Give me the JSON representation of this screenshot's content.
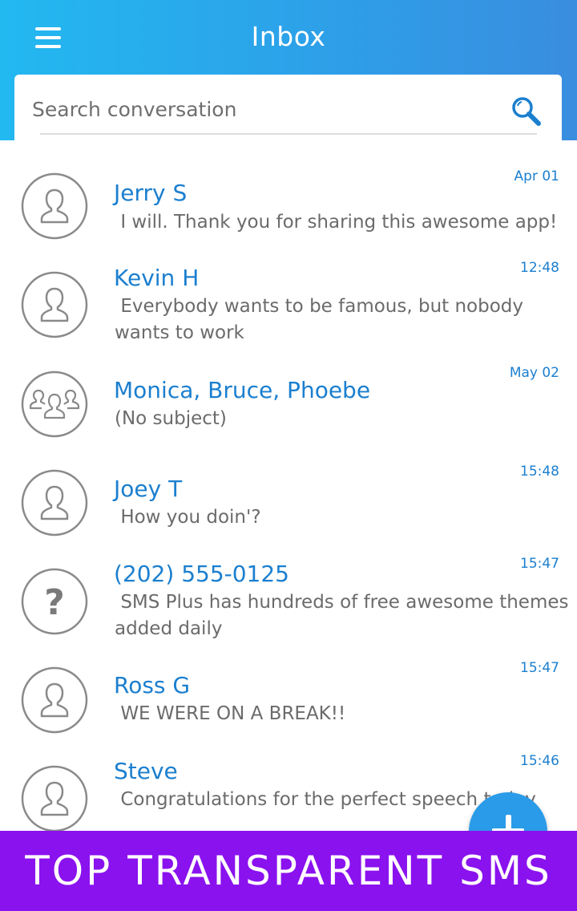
{
  "header": {
    "title": "Inbox"
  },
  "search": {
    "placeholder": "Search conversation"
  },
  "conversations": [
    {
      "name": "Jerry S",
      "date": "Apr 01",
      "preview": " I will. Thank you for sharing this awesome app!",
      "avatar": "person-icon"
    },
    {
      "name": "Kevin H",
      "date": "12:48",
      "preview": " Everybody wants to be famous, but nobody wants to work",
      "avatar": "person-icon"
    },
    {
      "name": "Monica, Bruce, Phoebe",
      "date": "May 02",
      "preview": "(No subject)",
      "avatar": "group-icon"
    },
    {
      "name": "Joey T",
      "date": "15:48",
      "preview": " How you doin'?",
      "avatar": "person-icon"
    },
    {
      "name": "(202) 555-0125",
      "date": "15:47",
      "preview": " SMS Plus has hundreds of free awesome themes added daily",
      "avatar": "unknown-contact-icon"
    },
    {
      "name": "Ross G",
      "date": "15:47",
      "preview": " WE WERE ON A BREAK!!",
      "avatar": "person-icon"
    },
    {
      "name": "Steve",
      "date": "15:46",
      "preview": " Congratulations for the perfect speech today",
      "avatar": "person-icon"
    }
  ],
  "banner": {
    "text": "TOP TRANSPARENT SMS"
  },
  "colors": {
    "accent": "#1b7fcf",
    "header_start": "#22b8f0",
    "header_end": "#3a8ddf",
    "banner": "#8a12ee"
  }
}
